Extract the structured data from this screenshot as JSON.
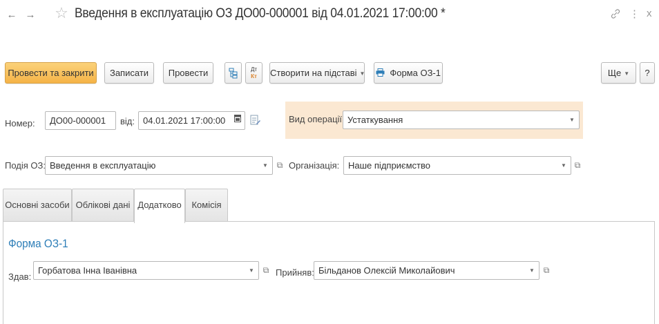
{
  "window": {
    "title": "Введення в експлуатацію ОЗ ДО00-000001 від 04.01.2021 17:00:00 *",
    "back_icon": "←",
    "forward_icon": "→",
    "favorite_icon": "☆",
    "link_icon": "🔗",
    "more_icon": "⋮",
    "close_icon": "x"
  },
  "toolbar": {
    "post_and_close": "Провести та закрити",
    "save": "Записати",
    "post": "Провести",
    "create_based_on": "Створити на підставі",
    "form_print": "Форма ОЗ-1",
    "more": "Ще",
    "help": "?"
  },
  "header": {
    "number_label": "Номер:",
    "number_value": "ДО00-000001",
    "date_label": "від:",
    "date_value": "04.01.2021 17:00:00",
    "operation_label": "Вид операції:",
    "operation_value": "Устаткування",
    "event_label": "Подія ОЗ:",
    "event_value": "Введення в експлуатацію",
    "org_label": "Організація:",
    "org_value": "Наше підприємство"
  },
  "tabs": [
    {
      "label": "Основні засоби"
    },
    {
      "label": "Облікові дані"
    },
    {
      "label": "Додатково"
    },
    {
      "label": "Комісія"
    }
  ],
  "additional": {
    "section_title": "Форма ОЗ-1",
    "handed_label": "Здав:",
    "handed_value": "Горбатова Інна Іванівна",
    "received_label": "Прийняв:",
    "received_value": "Більданов Олексій Миколайович"
  },
  "colors": {
    "primary_button": "#f5b347",
    "link": "#2f7fb8",
    "highlight": "#fbe8d2"
  }
}
